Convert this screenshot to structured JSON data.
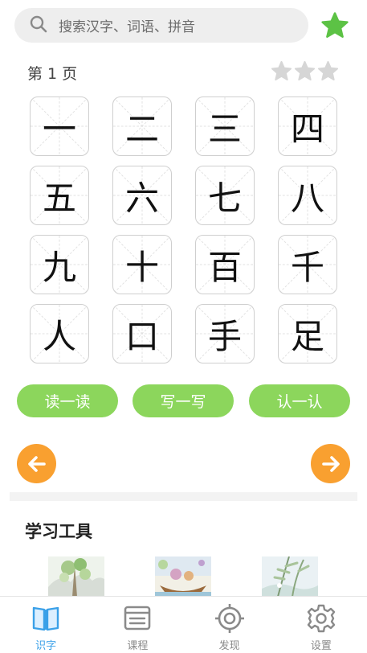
{
  "search": {
    "placeholder": "搜索汉字、词语、拼音"
  },
  "header": {
    "favorite_icon": "star-icon",
    "favorite_color": "#5cc245"
  },
  "page": {
    "label": "第 1 页",
    "rating": {
      "stars": 3,
      "filled": 0,
      "color": "#d6d6d6"
    }
  },
  "characters": [
    "一",
    "二",
    "三",
    "四",
    "五",
    "六",
    "七",
    "八",
    "九",
    "十",
    "百",
    "千",
    "人",
    "口",
    "手",
    "足"
  ],
  "actions": {
    "read": "读一读",
    "write": "写一写",
    "recognize": "认一认",
    "color": "#8cd65c"
  },
  "pager": {
    "prev_icon": "arrow-left-icon",
    "next_icon": "arrow-right-icon",
    "color": "#f9a030"
  },
  "tools": {
    "title": "学习工具"
  },
  "tabs": [
    {
      "label": "识字",
      "icon": "book-icon",
      "active": true
    },
    {
      "label": "课程",
      "icon": "course-icon",
      "active": false
    },
    {
      "label": "发现",
      "icon": "target-icon",
      "active": false
    },
    {
      "label": "设置",
      "icon": "gear-icon",
      "active": false
    }
  ],
  "colors": {
    "active_tab": "#3aa0e8",
    "inactive_tab": "#8a8a8a"
  }
}
